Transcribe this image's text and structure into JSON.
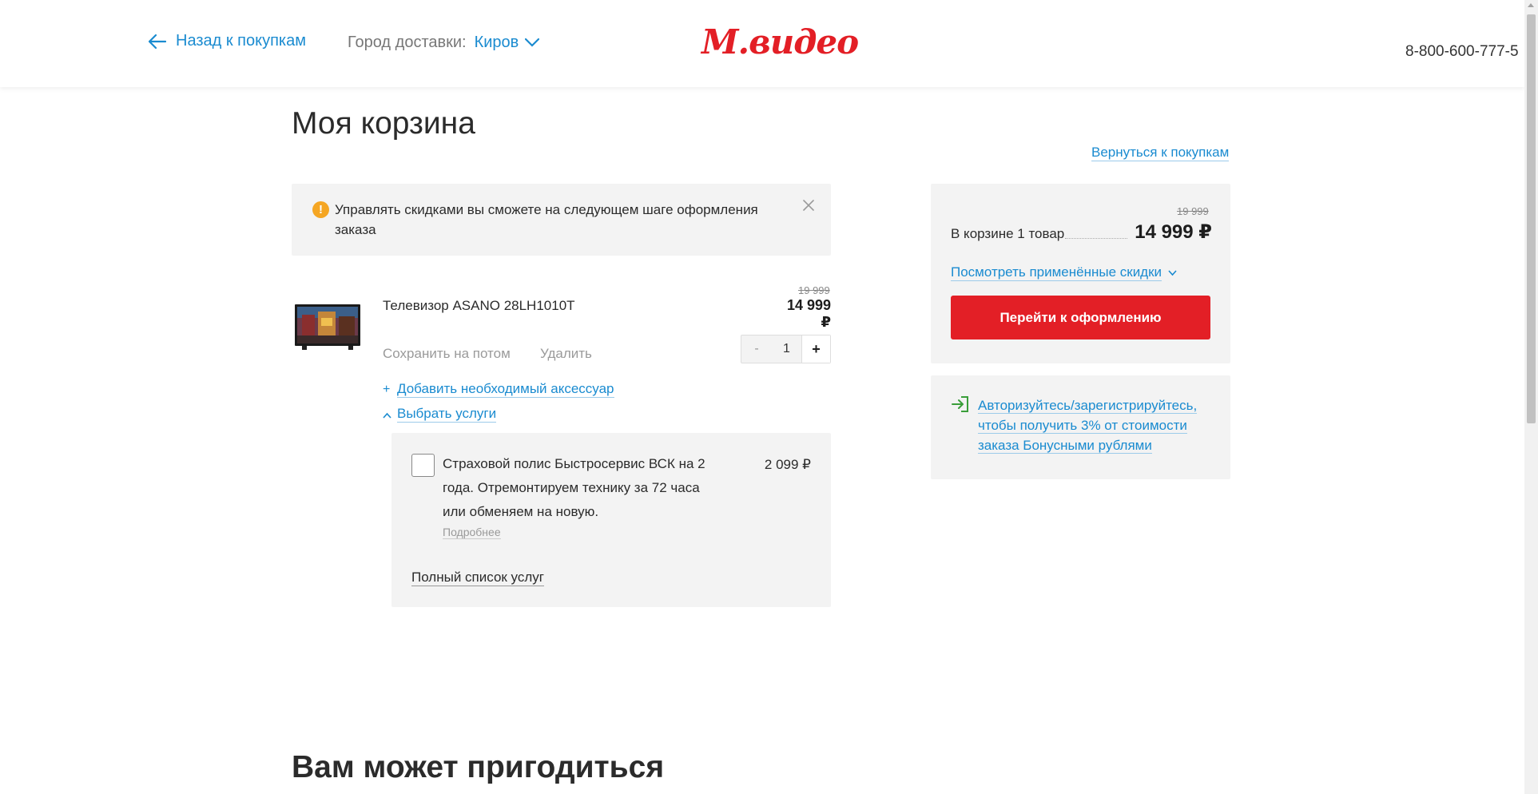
{
  "header": {
    "back_label": "Назад к покупкам",
    "city_label": "Город доставки:",
    "city_value": "Киров",
    "logo": "М.видео",
    "phone": "8-800-600-777-5"
  },
  "main": {
    "title": "Моя корзина",
    "return_link": "Вернуться к покупкам",
    "notice": {
      "text": "Управлять скидками вы сможете на следующем шаге оформления заказа",
      "icon": "!"
    },
    "product": {
      "name": "Телевизор ASANO 28LH1010T",
      "old_price": "19 999",
      "price": "14 999 ₽",
      "save_later": "Сохранить на потом",
      "delete": "Удалить",
      "qty_minus": "-",
      "qty": "1",
      "qty_plus": "+",
      "add_accessory_symbol": "+",
      "add_accessory": "Добавить необходимый аксессуар",
      "choose_services": "Выбрать услуги"
    },
    "services": {
      "item_text": "Страховой полис Быстросервис ВСК на 2 года. Отремонтируем технику за 72 часа или обменяем на новую.",
      "item_more": "Подробнее",
      "item_price": "2 099 ₽",
      "full_list": "Полный список услуг"
    },
    "related_title": "Вам может пригодиться"
  },
  "summary": {
    "old_price": "19 999",
    "label": "В корзине 1 товар",
    "price": "14 999 ₽",
    "discounts_link": "Посмотреть применённые скидки",
    "checkout": "Перейти к оформлению"
  },
  "auth": {
    "text": "Авторизуйтесь/зарегистрируйтесь, чтобы получить 3% от стоимости заказа Бонусными рублями"
  },
  "colors": {
    "brand_red": "#e31f26",
    "link_blue": "#1a8bd0",
    "warning": "#f5a623",
    "auth_green": "#3a9e3a"
  },
  "icons": [
    "arrow-left-icon",
    "chevron-down-icon",
    "warning-icon",
    "close-icon",
    "tv-image",
    "chevron-up-icon",
    "login-icon"
  ]
}
